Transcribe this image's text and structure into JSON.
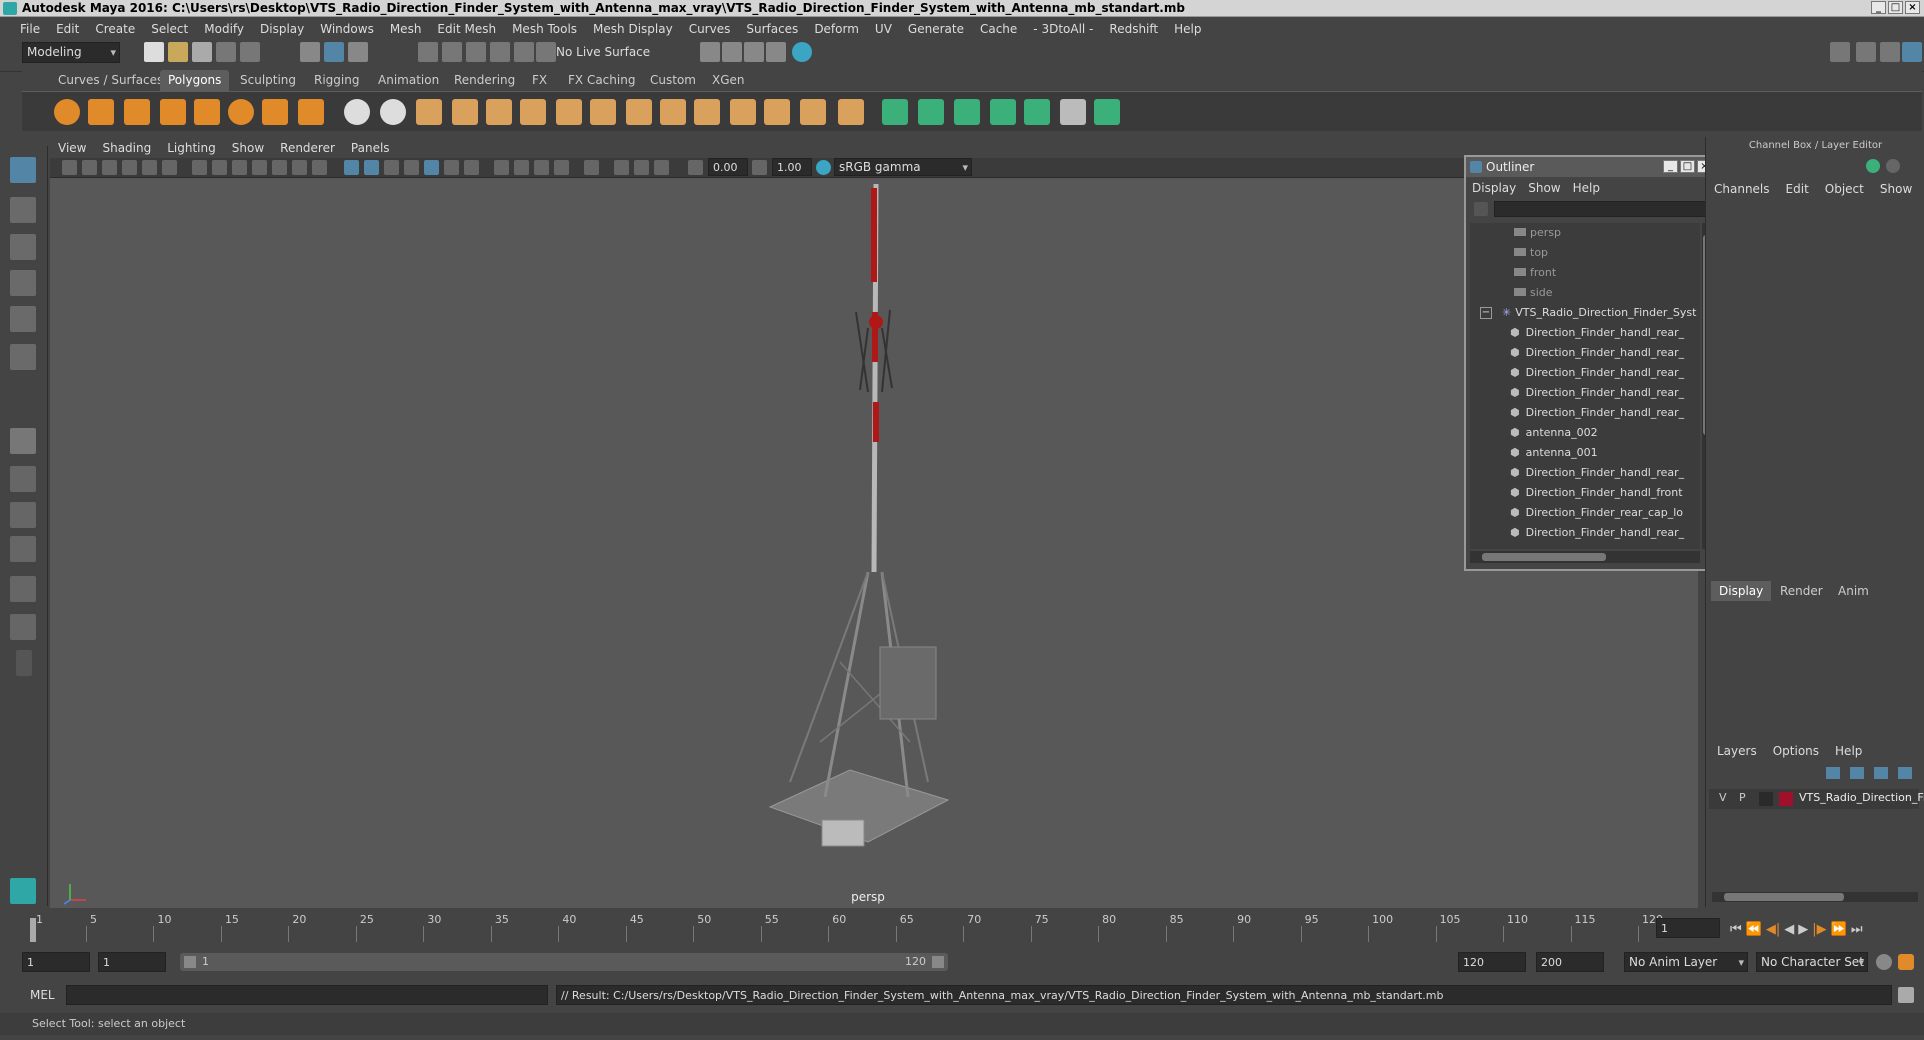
{
  "window": {
    "title": "Autodesk Maya 2016: C:\\Users\\rs\\Desktop\\VTS_Radio_Direction_Finder_System_with_Antenna_max_vray\\VTS_Radio_Direction_Finder_System_with_Antenna_mb_standart.mb"
  },
  "menubar": [
    "File",
    "Edit",
    "Create",
    "Select",
    "Modify",
    "Display",
    "Windows",
    "Mesh",
    "Edit Mesh",
    "Mesh Tools",
    "Mesh Display",
    "Curves",
    "Surfaces",
    "Deform",
    "UV",
    "Generate",
    "Cache",
    "- 3DtoAll -",
    "Redshift",
    "Help"
  ],
  "statusline": {
    "mode": "Modeling",
    "live_surface": "No Live Surface"
  },
  "shelf_tabs": [
    "Curves / Surfaces",
    "Polygons",
    "Sculpting",
    "Rigging",
    "Animation",
    "Rendering",
    "FX",
    "FX Caching",
    "Custom",
    "XGen"
  ],
  "shelf_active": "Polygons",
  "viewport": {
    "menu": [
      "View",
      "Shading",
      "Lighting",
      "Show",
      "Renderer",
      "Panels"
    ],
    "exposure": "0.00",
    "gamma": "1.00",
    "color_space": "sRGB gamma",
    "camera_label": "persp"
  },
  "outliner": {
    "title": "Outliner",
    "menu": [
      "Display",
      "Show",
      "Help"
    ],
    "cameras": [
      "persp",
      "top",
      "front",
      "side"
    ],
    "group": "VTS_Radio_Direction_Finder_Syst",
    "children": [
      "Direction_Finder_handl_rear_",
      "Direction_Finder_handl_rear_",
      "Direction_Finder_handl_rear_",
      "Direction_Finder_handl_rear_",
      "Direction_Finder_handl_rear_",
      "antenna_002",
      "antenna_001",
      "Direction_Finder_handl_rear_",
      "Direction_Finder_handl_front",
      "Direction_Finder_rear_cap_lo",
      "Direction_Finder_handl_rear_"
    ]
  },
  "channel_box": {
    "title": "Channel Box / Layer Editor",
    "menu": [
      "Channels",
      "Edit",
      "Object",
      "Show"
    ]
  },
  "layer_editor": {
    "tabs": [
      "Display",
      "Render",
      "Anim"
    ],
    "active_tab": "Display",
    "menu": [
      "Layers",
      "Options",
      "Help"
    ],
    "layer": {
      "v": "V",
      "p": "P",
      "name": "VTS_Radio_Direction_Fi",
      "color": "#a0102a"
    }
  },
  "timeline": {
    "ticks": [
      "1",
      "5",
      "10",
      "15",
      "20",
      "25",
      "30",
      "35",
      "40",
      "45",
      "50",
      "55",
      "60",
      "65",
      "70",
      "75",
      "80",
      "85",
      "90",
      "95",
      "100",
      "105",
      "110",
      "115",
      "120"
    ],
    "current_frame": "1"
  },
  "range": {
    "start": "1",
    "playback_start": "1",
    "slider_start": "1",
    "slider_end": "120",
    "playback_end": "120",
    "end": "200",
    "anim_layer": "No Anim Layer",
    "character_set": "No Character Set"
  },
  "command": {
    "language": "MEL",
    "result": "// Result: C:/Users/rs/Desktop/VTS_Radio_Direction_Finder_System_with_Antenna_max_vray/VTS_Radio_Direction_Finder_System_with_Antenna_mb_standart.mb"
  },
  "help_line": "Select Tool: select an object",
  "colors": {
    "accent": "#5285a6",
    "maya_teal": "#2fa7a7",
    "shelf_orange": "#e08a2a",
    "shelf_green": "#3bb07a"
  }
}
